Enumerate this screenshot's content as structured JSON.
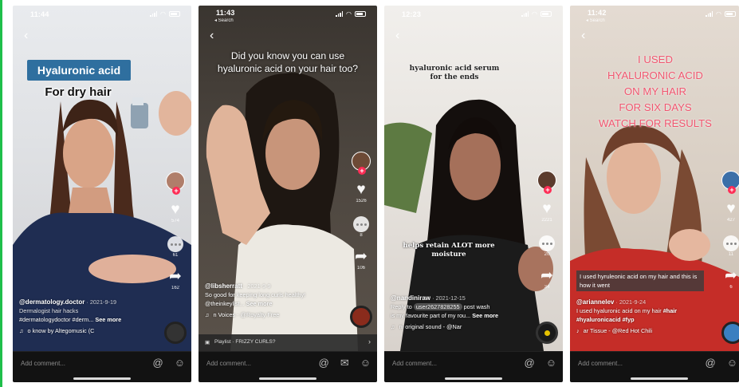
{
  "comment_placeholder": "Add comment...",
  "phones": [
    {
      "time": "11:44",
      "overlay_lines": [
        "Hyaluronic acid",
        "For dry hair"
      ],
      "likes": "574",
      "comments": "61",
      "shares": "162",
      "user": "@dermatology.doctor",
      "date": "· 2021-9-19",
      "desc1": "Dermalogist hair hacks",
      "desc2": "#dermatologydoctor #derm...",
      "more": "See more",
      "music": "o know by Altegomusic (C"
    },
    {
      "time": "11:43",
      "search_back": "◂ Search",
      "overlay": "Did you know you can use hyaluronic acid on your hair too?",
      "likes": "1526",
      "comments": "8",
      "shares": "106",
      "user": "@libsherratt",
      "date": "· 2021-9-9",
      "desc1": "So good for keeping long curls healthy!",
      "desc2": "@theinkeylist...",
      "more": "See more",
      "music": "n Voices - @Royalty Free",
      "playlist": "Playlist · FRIZZY CURLS?"
    },
    {
      "time": "12:23",
      "overlay_top": "hyaluronic acid serum for the ends",
      "overlay_mid": "helps retain ALOT more moisture",
      "likes": "2221",
      "comments": "20",
      "shares": "34",
      "user": "@nandiniraw",
      "date": "· 2021-12-15",
      "reply_to": "Reply to",
      "reply_user": "user2627828255",
      "reply_text": "post wash",
      "desc1": "is my favourite part of my rou...",
      "more": "See more",
      "music": "ni    original sound - @Nar"
    },
    {
      "time": "11:42",
      "search_back": "◂ Search",
      "overlay_lines": [
        "I USED",
        "HYALURONIC ACID",
        "ON MY HAIR",
        "FOR SIX DAYS",
        "WATCH FOR RESULTS"
      ],
      "overlay_mid": "I used hyruleonic acid on my hair and this is how it went",
      "likes": "427",
      "comments": "11",
      "shares": "6",
      "user": "@ariannelev",
      "date": "· 2021-9-24",
      "desc1": "I used hyaluronic acid on my hair",
      "desc1_tag": "#hair",
      "desc2": "#hyaluronicacid #fyp",
      "music": "ar Tissue - @Red Hot Chili"
    }
  ],
  "colors": {
    "tiktok_red": "#fe2c55",
    "label_blue": "#2f6f9f",
    "pink_text": "#f0566f"
  }
}
